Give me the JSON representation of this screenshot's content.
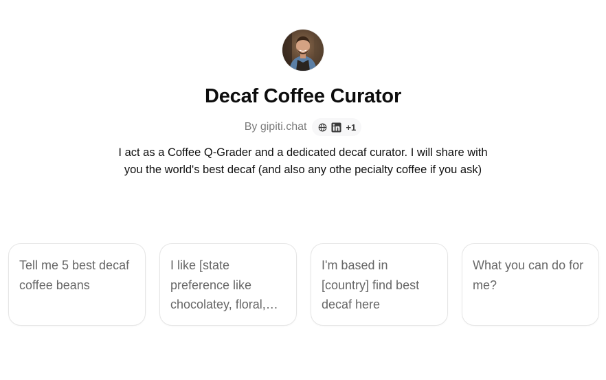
{
  "gpt": {
    "name": "Decaf Coffee Curator",
    "author": "By gipiti.chat",
    "social": {
      "icons": [
        "globe-icon",
        "linkedin-icon"
      ],
      "more": "+1"
    },
    "description": "I act as a Coffee Q-Grader and a dedicated decaf curator. I will share with you the world's best decaf (and also any othe pecialty coffee if you ask)"
  },
  "starters": [
    {
      "label": "Tell me 5 best decaf coffee beans"
    },
    {
      "label": "I like [state preference like chocolatey, floral, fruity]"
    },
    {
      "label": "I'm based in [country] find best decaf here"
    },
    {
      "label": "What you can do for me?"
    }
  ],
  "colors": {
    "text": "#0d0d0d",
    "muted": "#7b7b7b",
    "card_text": "#676767",
    "card_border": "#e5e5e5",
    "pill_bg": "#f7f7f8"
  }
}
